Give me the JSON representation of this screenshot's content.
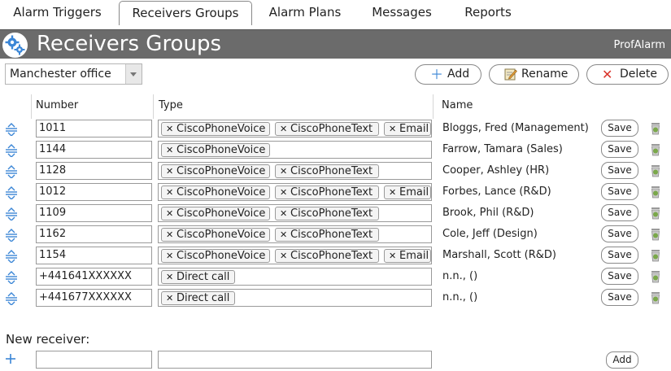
{
  "tabs": [
    "Alarm Triggers",
    "Receivers Groups",
    "Alarm Plans",
    "Messages",
    "Reports"
  ],
  "header": {
    "title": "Receivers Groups",
    "brand": "ProfAlarm"
  },
  "group_select": {
    "value": "Manchester office"
  },
  "buttons": {
    "add": "Add",
    "rename": "Rename",
    "delete": "Delete"
  },
  "columns": {
    "number": "Number",
    "type": "Type",
    "name": "Name"
  },
  "save_label": "Save",
  "rows": [
    {
      "number": "1011",
      "tags": [
        "CiscoPhoneVoice",
        "CiscoPhoneText",
        "Email"
      ],
      "name": "Bloggs, Fred (Management)"
    },
    {
      "number": "1144",
      "tags": [
        "CiscoPhoneVoice"
      ],
      "name": "Farrow, Tamara (Sales)"
    },
    {
      "number": "1128",
      "tags": [
        "CiscoPhoneVoice",
        "CiscoPhoneText"
      ],
      "name": "Cooper, Ashley (HR)"
    },
    {
      "number": "1012",
      "tags": [
        "CiscoPhoneVoice",
        "CiscoPhoneText",
        "Email"
      ],
      "name": "Forbes, Lance (R&D)"
    },
    {
      "number": "1109",
      "tags": [
        "CiscoPhoneVoice",
        "CiscoPhoneText"
      ],
      "name": "Brook, Phil (R&D)"
    },
    {
      "number": "1162",
      "tags": [
        "CiscoPhoneVoice",
        "CiscoPhoneText"
      ],
      "name": "Cole, Jeff (Design)"
    },
    {
      "number": "1154",
      "tags": [
        "CiscoPhoneVoice",
        "CiscoPhoneText",
        "Email"
      ],
      "name": "Marshall, Scott (R&D)"
    },
    {
      "number": "+441641XXXXXX",
      "tags": [
        "Direct call"
      ],
      "name": "n.n., ()"
    },
    {
      "number": "+441677XXXXXX",
      "tags": [
        "Direct call"
      ],
      "name": "n.n., ()"
    }
  ],
  "new_receiver": {
    "label": "New receiver:",
    "add_label": "Add"
  },
  "colors": {
    "header_bg": "#6b6b6b",
    "accent_blue": "#3b86d6",
    "delete_red": "#d9342b",
    "trash_green": "#7aa84a"
  }
}
